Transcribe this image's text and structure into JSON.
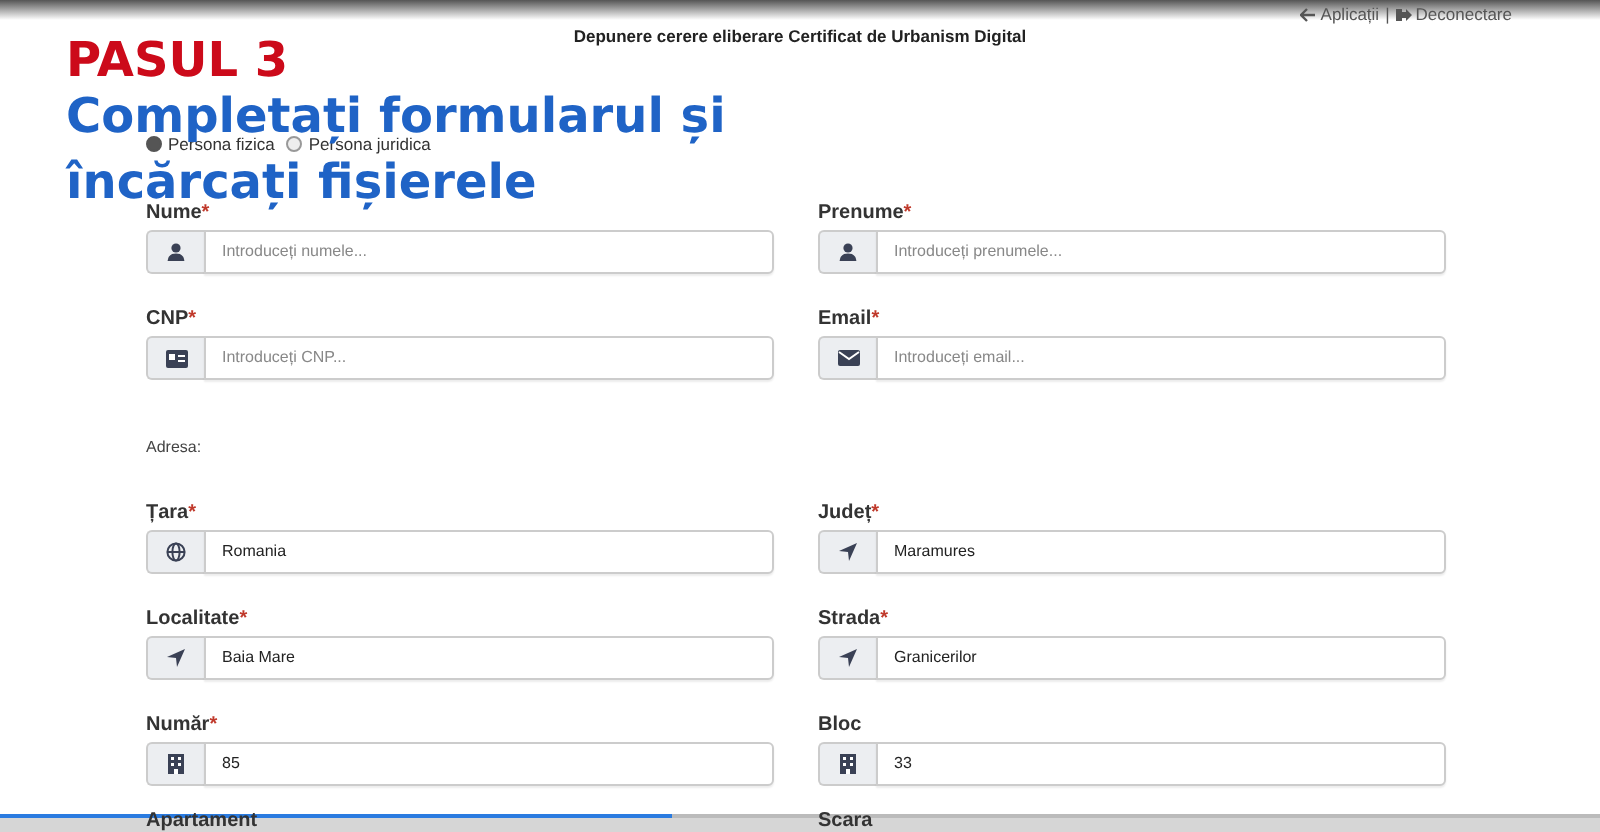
{
  "header": {
    "title": "Depunere cerere eliberare Certificat de Urbanism Digital",
    "links": [
      {
        "kind": "back",
        "label": "Aplicații"
      },
      {
        "kind": "logout",
        "label": "Deconectare"
      }
    ],
    "separator": "|"
  },
  "person_type": [
    {
      "label": "Persona fizica",
      "selected": true
    },
    {
      "label": "Persona juridica",
      "selected": false
    }
  ],
  "personal_fields": [
    {
      "label": "Nume",
      "required_mark": "*",
      "kind": "user",
      "placeholder": "Introduceți numele..."
    },
    {
      "label": "Prenume",
      "required_mark": "*",
      "kind": "user",
      "placeholder": "Introduceți prenumele..."
    },
    {
      "label": "CNP",
      "required_mark": "*",
      "kind": "idcard",
      "placeholder": "Introduceți CNP..."
    },
    {
      "label": "Email",
      "required_mark": "*",
      "kind": "envelope",
      "placeholder": "Introduceți email..."
    }
  ],
  "address_label": "Adresa:",
  "address_fields": [
    {
      "label": "Țara",
      "required_mark": "*",
      "kind": "globe",
      "value": "Romania"
    },
    {
      "label": "Județ",
      "required_mark": "*",
      "kind": "arrow",
      "value": "Maramures"
    },
    {
      "label": "Localitate",
      "required_mark": "*",
      "kind": "arrow",
      "value": "Baia Mare"
    },
    {
      "label": "Strada",
      "required_mark": "*",
      "kind": "arrow",
      "value": "Granicerilor"
    },
    {
      "label": "Număr",
      "required_mark": "*",
      "kind": "building",
      "value": "85"
    },
    {
      "label": "Bloc",
      "kind": "building",
      "value": "33"
    },
    {
      "label": "Apartament",
      "kind": "cut"
    },
    {
      "label": "Scara",
      "kind": "cut"
    }
  ],
  "overlay": {
    "step": "PASUL 3",
    "lines": [
      "Completați formularul și",
      "încărcați fișierele"
    ]
  },
  "video": {
    "level": 0.42
  }
}
